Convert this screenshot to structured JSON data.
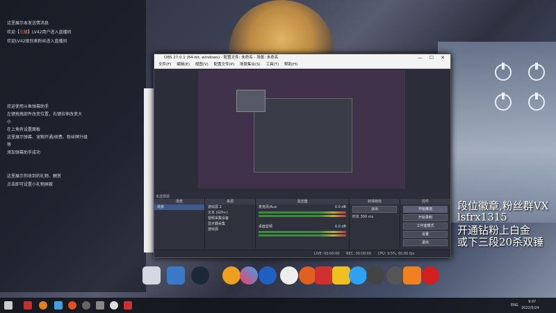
{
  "obs": {
    "title": "OBS 27.0.1 (64-bit, windows) - 配置文件: 未命名 - 场景: 未命名",
    "menu": [
      "文件(F)",
      "编辑(E)",
      "视图(V)",
      "配置文件(P)",
      "场景集合(S)",
      "工具(T)",
      "帮助(H)"
    ],
    "docks": {
      "scenes_header": "场景",
      "scene_item": "场景",
      "sources_header": "来源",
      "sources": [
        "游戏源 2",
        "文本 (GDI+)",
        "视频采集设备",
        "显示器采集",
        "游戏源"
      ],
      "mixer_header": "混音器",
      "mixer": [
        {
          "name": "麦克风/Aux",
          "level": "0.0 dB"
        },
        {
          "name": "桌面音频",
          "level": "0.0 dB"
        }
      ],
      "transitions_header": "转场特效",
      "transition_type": "淡出",
      "duration_label": "时长",
      "duration": "300 ms",
      "controls_header": "控件",
      "controls": [
        "开始推流",
        "开始录制",
        "工作室模式",
        "设置",
        "退出"
      ]
    },
    "status": {
      "dropped": "LIVE: 00:00:00",
      "rec": "REC: 00:00:00",
      "cpu": "CPU: 9.5%, 60.00 fps"
    },
    "scene_label": "未选择源"
  },
  "chat": {
    "lines": [
      "这里展示本发送情消息",
      "欢迎【三级】LV42用户进入直播间",
      "欢迎LV42级别表粉丝进入直播间",
      "欢迎使用斗鱼弹幕助手",
      "左键拖拽部件改变位置，右键拉伸改变大",
      "小",
      "在上角有设置面板",
      "这里展示弹幕、宠物开通/续费、粉丝牌升级",
      "等",
      "添加弹幕助手成功",
      "这里展示你收到的礼物、酬赏",
      "点击即可设置小礼物屏蔽"
    ],
    "highlight": "三级"
  },
  "promo": {
    "line1": "段位徽章,粉丝群VX",
    "line2": "lsfrx1315",
    "line3": "开通钻粉上白金",
    "line4": "或下三段20杀双锤"
  },
  "clock": {
    "time": "9:07",
    "date": "2022/5/24"
  },
  "tray_lang": "ENG",
  "colors": {
    "accent": "#3d5a8a",
    "meter_green": "#3c8c3c",
    "meter_red": "#b84040"
  }
}
